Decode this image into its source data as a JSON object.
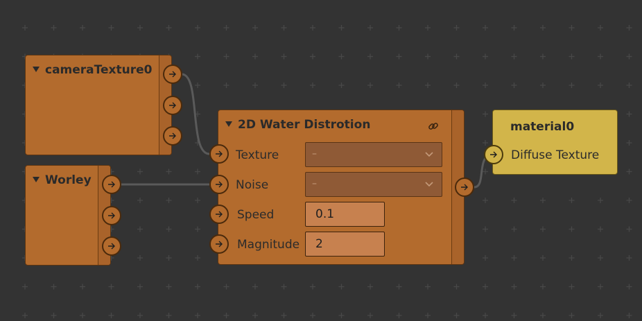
{
  "colors": {
    "canvas_bg": "#333333",
    "grid_cross": "#484848",
    "node_orange": "#b36b2d",
    "node_border": "#5e3511",
    "output_node_yellow": "#d2b54a",
    "wire": "#5a5a5a"
  },
  "nodes": {
    "camera_texture": {
      "title": "cameraTexture0",
      "outputs": [
        "out-1",
        "out-2",
        "out-3"
      ]
    },
    "worley": {
      "title": "Worley",
      "outputs": [
        "out-1",
        "out-2",
        "out-3"
      ]
    },
    "water_distortion": {
      "title": "2D Water Distrotion",
      "link_icon": "link-icon",
      "params": {
        "texture": {
          "label": "Texture",
          "value": "–"
        },
        "noise": {
          "label": "Noise",
          "value": "–"
        },
        "speed": {
          "label": "Speed",
          "value": "0.1"
        },
        "magnitude": {
          "label": "Magnitude",
          "value": "2"
        }
      }
    },
    "material": {
      "title": "material0",
      "input_label": "Diffuse Texture"
    }
  },
  "connections": [
    {
      "from": "cameraTexture0.out-1",
      "to": "2D Water Distrotion.Texture"
    },
    {
      "from": "Worley.out-1",
      "to": "2D Water Distrotion.Noise"
    },
    {
      "from": "2D Water Distrotion.out",
      "to": "material0.Diffuse Texture"
    }
  ]
}
